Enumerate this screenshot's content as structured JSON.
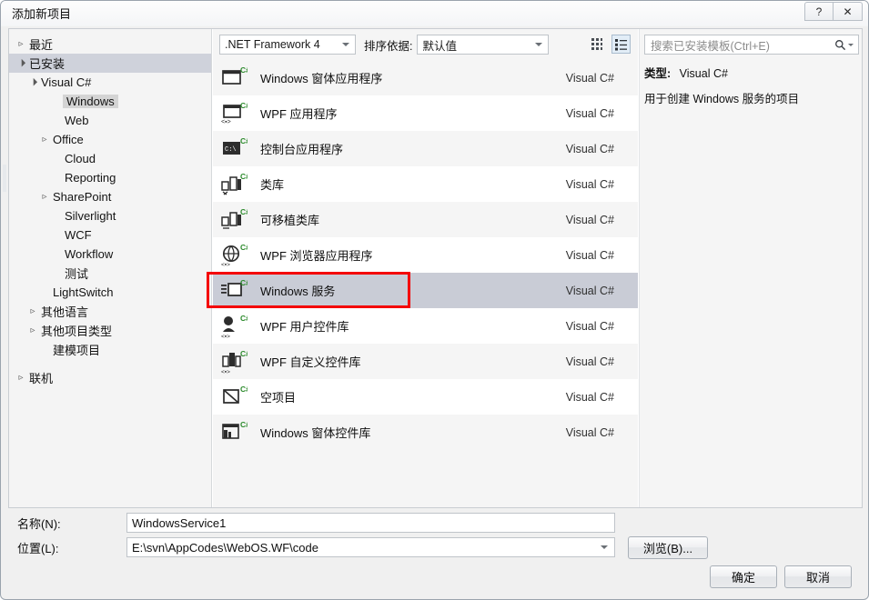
{
  "window": {
    "title": "添加新项目",
    "help_label": "?",
    "close_label": "✕"
  },
  "sidebar": {
    "items": [
      {
        "label": "最近",
        "indent": 0,
        "arrow": "closed",
        "selected": false
      },
      {
        "label": "已安装",
        "indent": 0,
        "arrow": "open",
        "selected": true
      },
      {
        "label": "Visual C#",
        "indent": 1,
        "arrow": "open",
        "selected": false
      },
      {
        "label": "Windows",
        "indent": 3,
        "arrow": "none",
        "selected": false,
        "highlight": true
      },
      {
        "label": "Web",
        "indent": 3,
        "arrow": "none",
        "selected": false
      },
      {
        "label": "Office",
        "indent": 2,
        "arrow": "closed",
        "selected": false
      },
      {
        "label": "Cloud",
        "indent": 3,
        "arrow": "none",
        "selected": false
      },
      {
        "label": "Reporting",
        "indent": 3,
        "arrow": "none",
        "selected": false
      },
      {
        "label": "SharePoint",
        "indent": 2,
        "arrow": "closed",
        "selected": false
      },
      {
        "label": "Silverlight",
        "indent": 3,
        "arrow": "none",
        "selected": false
      },
      {
        "label": "WCF",
        "indent": 3,
        "arrow": "none",
        "selected": false
      },
      {
        "label": "Workflow",
        "indent": 3,
        "arrow": "none",
        "selected": false
      },
      {
        "label": "测试",
        "indent": 3,
        "arrow": "none",
        "selected": false
      },
      {
        "label": "LightSwitch",
        "indent": 2,
        "arrow": "none",
        "selected": false
      },
      {
        "label": "其他语言",
        "indent": 1,
        "arrow": "closed",
        "selected": false
      },
      {
        "label": "其他项目类型",
        "indent": 1,
        "arrow": "closed",
        "selected": false
      },
      {
        "label": "建模项目",
        "indent": 2,
        "arrow": "none",
        "selected": false
      },
      {
        "label": "",
        "indent": 0,
        "arrow": "none",
        "selected": false,
        "spacer": true
      },
      {
        "label": "联机",
        "indent": 0,
        "arrow": "closed",
        "selected": false
      }
    ]
  },
  "toolbar": {
    "framework": ".NET Framework 4",
    "sort_label": "排序依据:",
    "sort_value": "默认值",
    "view_medium_icons": "medium-icons-view-icon",
    "view_details": "details-view-icon"
  },
  "templates": {
    "lang_column": "Visual C#",
    "rows": [
      {
        "name": "Windows 窗体应用程序",
        "lang": "Visual C#",
        "icon": "windows-forms-app-icon",
        "selected": false
      },
      {
        "name": "WPF 应用程序",
        "lang": "Visual C#",
        "icon": "wpf-app-icon",
        "selected": false
      },
      {
        "name": "控制台应用程序",
        "lang": "Visual C#",
        "icon": "console-app-icon",
        "selected": false
      },
      {
        "name": "类库",
        "lang": "Visual C#",
        "icon": "class-library-icon",
        "selected": false
      },
      {
        "name": "可移植类库",
        "lang": "Visual C#",
        "icon": "portable-class-lib-icon",
        "selected": false
      },
      {
        "name": "WPF 浏览器应用程序",
        "lang": "Visual C#",
        "icon": "wpf-browser-app-icon",
        "selected": false
      },
      {
        "name": "Windows 服务",
        "lang": "Visual C#",
        "icon": "windows-service-icon",
        "selected": true
      },
      {
        "name": "WPF 用户控件库",
        "lang": "Visual C#",
        "icon": "wpf-user-control-icon",
        "selected": false
      },
      {
        "name": "WPF 自定义控件库",
        "lang": "Visual C#",
        "icon": "wpf-custom-control-icon",
        "selected": false
      },
      {
        "name": "空项目",
        "lang": "Visual C#",
        "icon": "empty-project-icon",
        "selected": false
      },
      {
        "name": "Windows 窗体控件库",
        "lang": "Visual C#",
        "icon": "winforms-control-lib-icon",
        "selected": false
      }
    ]
  },
  "search": {
    "placeholder": "搜索已安装模板(Ctrl+E)",
    "icon": "search-icon"
  },
  "details": {
    "type_label": "类型:",
    "type_value": "Visual C#",
    "description": "用于创建 Windows 服务的项目"
  },
  "fields": {
    "name_label": "名称(N):",
    "name_value": "WindowsService1",
    "location_label": "位置(L):",
    "location_value": "E:\\svn\\AppCodes\\WebOS.WF\\code"
  },
  "buttons": {
    "browse": "浏览(B)...",
    "ok": "确定",
    "cancel": "取消"
  },
  "colors": {
    "annotation": "#f40000",
    "selected_row": "#c9ccd6",
    "tree_selected": "#cfd2db"
  }
}
